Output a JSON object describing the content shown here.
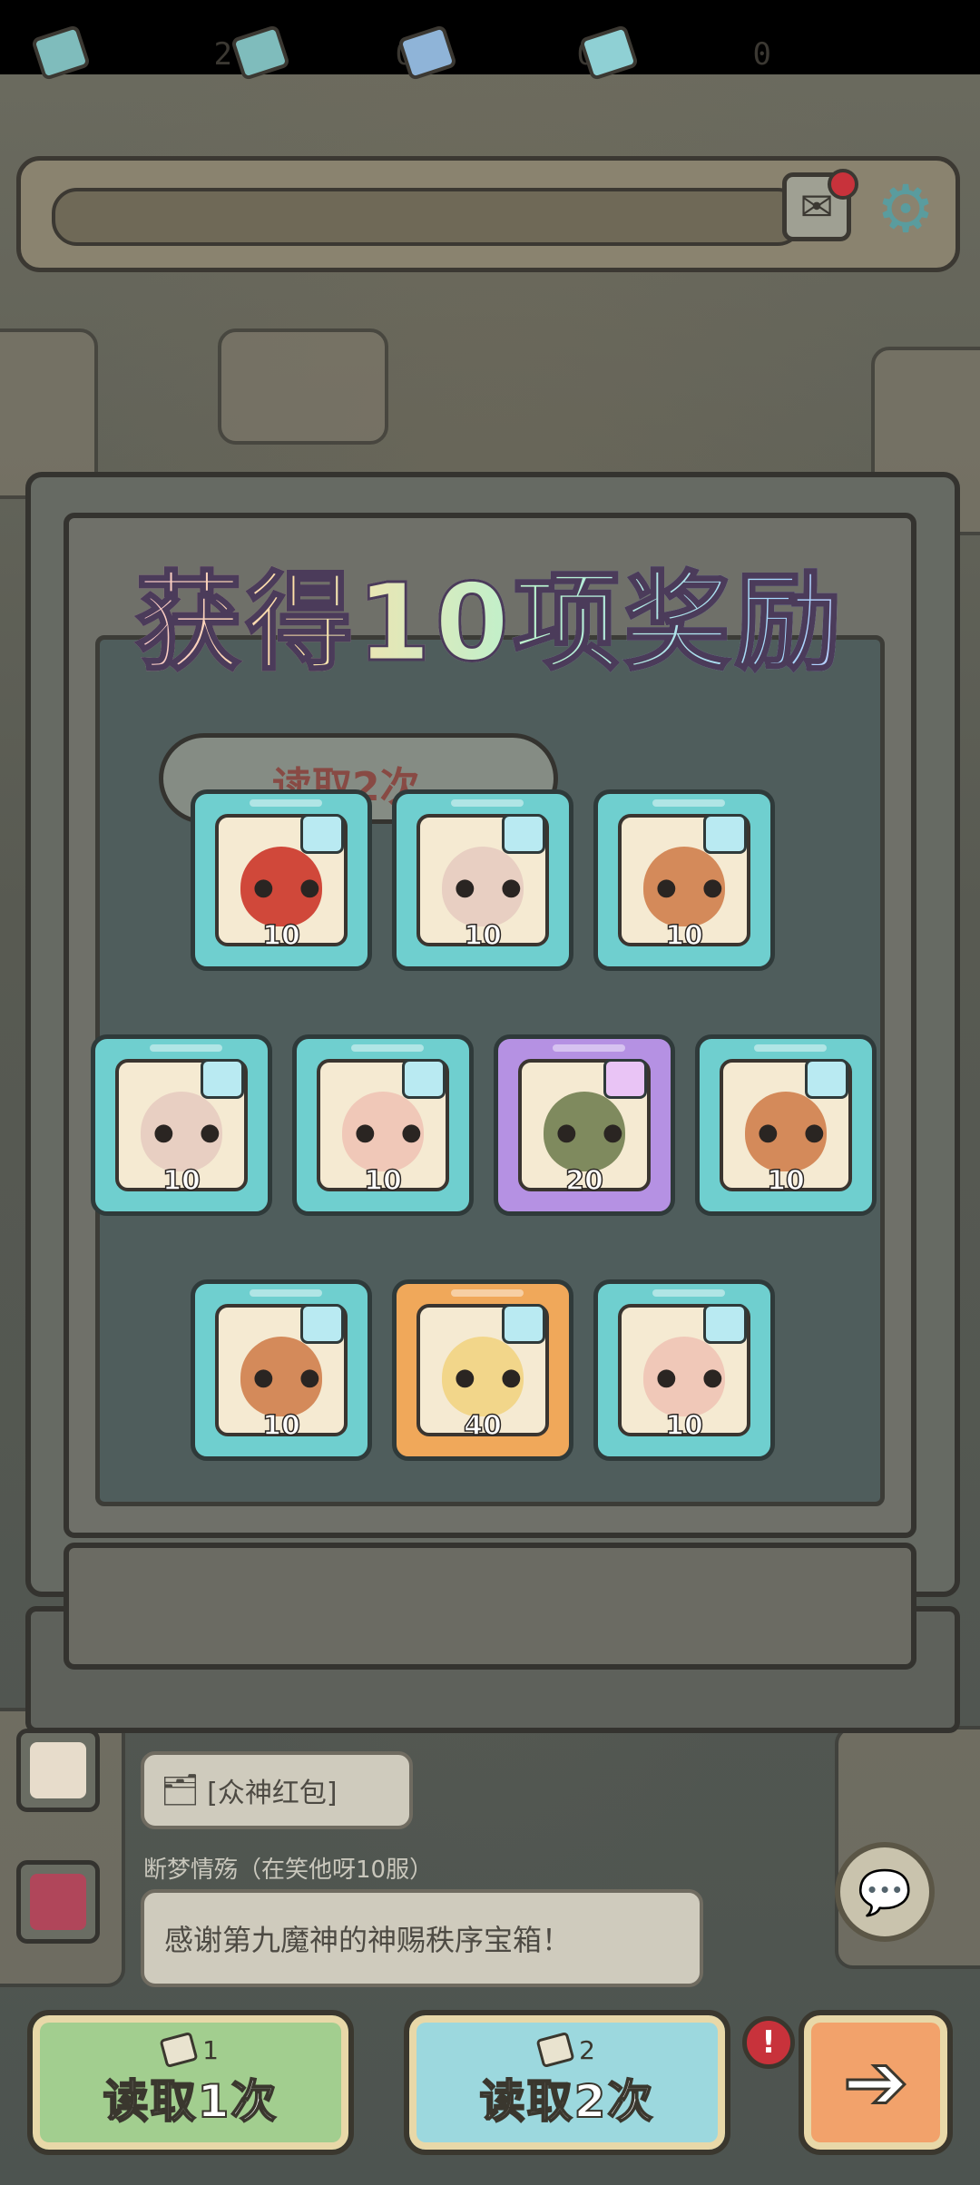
{
  "resources": [
    {
      "name": "ticket-green",
      "count": "2"
    },
    {
      "name": "ticket-blue",
      "count": "0"
    },
    {
      "name": "ticket-teal",
      "count": "0"
    },
    {
      "name": "ticket-special",
      "count": "0"
    }
  ],
  "title": "获得10项奖励",
  "background_banner": "读取2次",
  "rewards": [
    {
      "frame": "teal",
      "count": "10",
      "face": "#d0483a"
    },
    {
      "frame": "teal",
      "count": "10",
      "face": "#e8cfc2"
    },
    {
      "frame": "teal",
      "count": "10",
      "face": "#d48a5a"
    },
    {
      "frame": "teal",
      "count": "10",
      "face": "#e8cfc2"
    },
    {
      "frame": "teal",
      "count": "10",
      "face": "#f0c8b8"
    },
    {
      "frame": "purple",
      "count": "20",
      "face": "#7f8a5e"
    },
    {
      "frame": "teal",
      "count": "10",
      "face": "#d48a5a"
    },
    {
      "frame": "teal",
      "count": "10",
      "face": "#d48a5a"
    },
    {
      "frame": "orange",
      "count": "40",
      "face": "#f2d68a"
    },
    {
      "frame": "teal",
      "count": "10",
      "face": "#f0c8b8"
    }
  ],
  "chat": {
    "red_packet": "[众神红包]",
    "nickname": "断梦情殇（在笑他呀10服）",
    "message": "感谢第九魔神的神赐秩序宝箱！"
  },
  "buttons": {
    "read_once": {
      "cost": "1",
      "label": "读取1次"
    },
    "read_twice": {
      "cost": "2",
      "label": "读取2次"
    },
    "alert": "!"
  },
  "colors": {
    "teal_frame": "#6fcfcf",
    "purple_frame": "#b591e3",
    "orange_frame": "#f0a85a"
  }
}
